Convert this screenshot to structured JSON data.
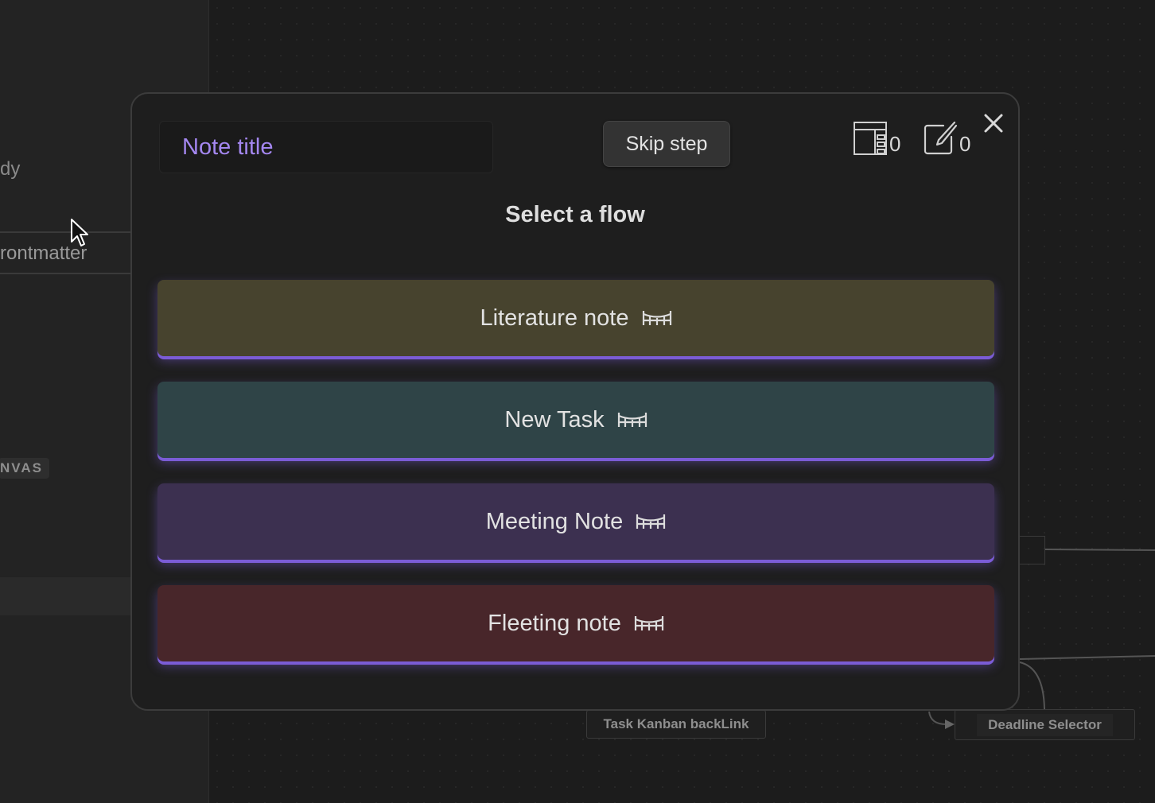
{
  "sidebar": {
    "snippet_1": "dy",
    "snippet_2": "rontmatter",
    "badge": "NVAS"
  },
  "canvas": {
    "nodes": [
      "Task Kanban backLink",
      "Deadline Selector"
    ]
  },
  "modal": {
    "title_placeholder": "Note title",
    "skip_label": "Skip step",
    "templates_count": "0",
    "notes_count": "0",
    "heading": "Select a flow",
    "flows": [
      {
        "label": "Literature note",
        "icon": "bridge-icon",
        "color": "#47432e"
      },
      {
        "label": "New Task",
        "icon": "bridge-icon",
        "color": "#2f4447"
      },
      {
        "label": "Meeting Note",
        "icon": "bridge-icon",
        "color": "#3c3050"
      },
      {
        "label": "Fleeting note",
        "icon": "bridge-icon",
        "color": "#48262a"
      }
    ],
    "accent": "#7b5cd6"
  }
}
